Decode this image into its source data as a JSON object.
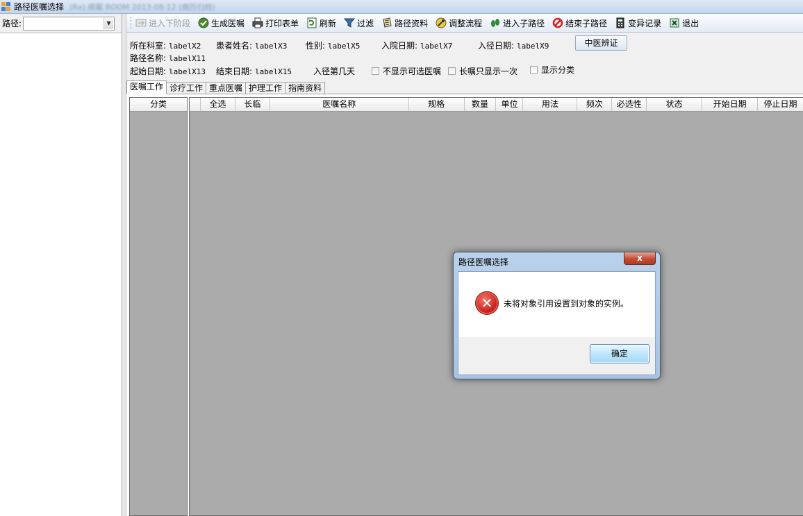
{
  "window": {
    "title": "路径医嘱选择",
    "title_extra": "(Rx) 病案 ROOM 2013-08-12 (病历归档)"
  },
  "left_panel": {
    "path_label": "路径:",
    "path_value": ""
  },
  "toolbar": {
    "items": [
      {
        "label": "进入下阶段",
        "icon": "next-stage-icon",
        "disabled": true
      },
      {
        "label": "生成医嘱",
        "icon": "generate-order-icon"
      },
      {
        "label": "打印表单",
        "icon": "printer-icon"
      },
      {
        "label": "刷新",
        "icon": "refresh-icon"
      },
      {
        "label": "过滤",
        "icon": "filter-funnel-icon"
      },
      {
        "label": "路径资料",
        "icon": "document-icon"
      },
      {
        "label": "调整流程",
        "icon": "adjust-flow-icon"
      },
      {
        "label": "进入子路径",
        "icon": "footprints-icon"
      },
      {
        "label": "结束子路径",
        "icon": "stop-icon"
      },
      {
        "label": "变异记录",
        "icon": "calculator-icon"
      },
      {
        "label": "退出",
        "icon": "exit-icon"
      }
    ]
  },
  "info": {
    "dept_label": "所在科室:",
    "dept_value": "labelX2",
    "patient_label": "患者姓名:",
    "patient_value": "labelX3",
    "gender_label": "性别:",
    "gender_value": "labelX5",
    "admit_label": "入院日期:",
    "admit_value": "labelX7",
    "enter_label": "入径日期:",
    "enter_value": "labelX9",
    "tcm_button": "中医辨证",
    "path_name_label": "路径名称:",
    "path_name_value": "labelX11",
    "start_label": "起始日期:",
    "start_value": "labelX13",
    "end_label": "结束日期:",
    "end_value": "labelX15",
    "day_label": "入径第几天",
    "chk_hide_optional": "不显示可选医嘱",
    "chk_long_once": "长嘱只显示一次",
    "chk_show_category": "显示分类"
  },
  "tabs": [
    "医嘱工作",
    "诊疗工作",
    "重点医嘱",
    "护理工作",
    "指南资料"
  ],
  "category_grid": {
    "header": "分类"
  },
  "order_grid": {
    "columns": [
      "",
      "全选",
      "长临",
      "医嘱名称",
      "规格",
      "数量",
      "单位",
      "用法",
      "频次",
      "必选性",
      "状态",
      "开始日期",
      "停止日期"
    ]
  },
  "dialog": {
    "title": "路径医嘱选择",
    "close": "x",
    "message": "未将对象引用设置到对象的实例。",
    "ok": "确定",
    "icon": "error-icon"
  }
}
